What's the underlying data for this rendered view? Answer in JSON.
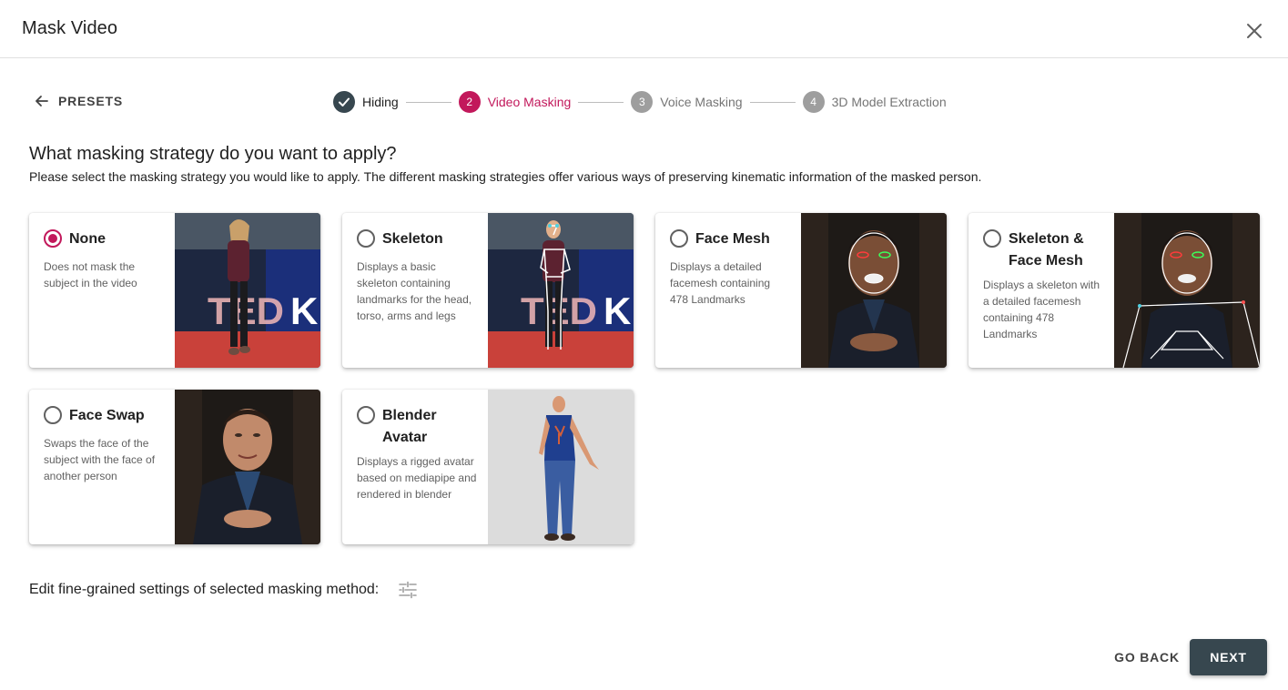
{
  "dialog": {
    "title": "Mask Video",
    "close_icon": "close-icon"
  },
  "nav": {
    "back_label": "PRESETS",
    "back_icon": "arrow-left-icon"
  },
  "stepper": {
    "steps": [
      {
        "number": "",
        "label": "Hiding",
        "state": "completed"
      },
      {
        "number": "2",
        "label": "Video Masking",
        "state": "active"
      },
      {
        "number": "3",
        "label": "Voice Masking",
        "state": "pending"
      },
      {
        "number": "4",
        "label": "3D Model Extraction",
        "state": "pending"
      }
    ]
  },
  "main": {
    "heading": "What masking strategy do you want to apply?",
    "subheading": "Please select the masking strategy you would like to apply. The different masking strategies offer various ways of preserving kinematic information of the masked person."
  },
  "strategies": [
    {
      "title": "None",
      "description": "Does not mask the subject in the video",
      "selected": true
    },
    {
      "title": "Skeleton",
      "description": "Displays a basic skeleton containing landmarks for the head, torso, arms and legs",
      "selected": false
    },
    {
      "title": "Face Mesh",
      "description": "Displays a detailed facemesh containing 478 Landmarks",
      "selected": false
    },
    {
      "title": "Skeleton & Face Mesh",
      "description": "Displays a skeleton with a detailed facemesh containing 478 Landmarks",
      "selected": false
    },
    {
      "title": "Face Swap",
      "description": "Swaps the face of the subject with the face of another person",
      "selected": false
    },
    {
      "title": "Blender Avatar",
      "description": "Displays a rigged avatar based on mediapipe and rendered in blender",
      "selected": false
    }
  ],
  "thumbnails": {
    "ted_text": "TEDxK"
  },
  "settings": {
    "label": "Edit fine-grained settings of selected masking method:",
    "icon": "tune-icon"
  },
  "footer": {
    "back_label": "GO BACK",
    "next_label": "NEXT"
  },
  "colors": {
    "accent": "#c2185b",
    "primary_button": "#37474f",
    "step_completed": "#37474f",
    "step_pending": "#9e9e9e"
  }
}
